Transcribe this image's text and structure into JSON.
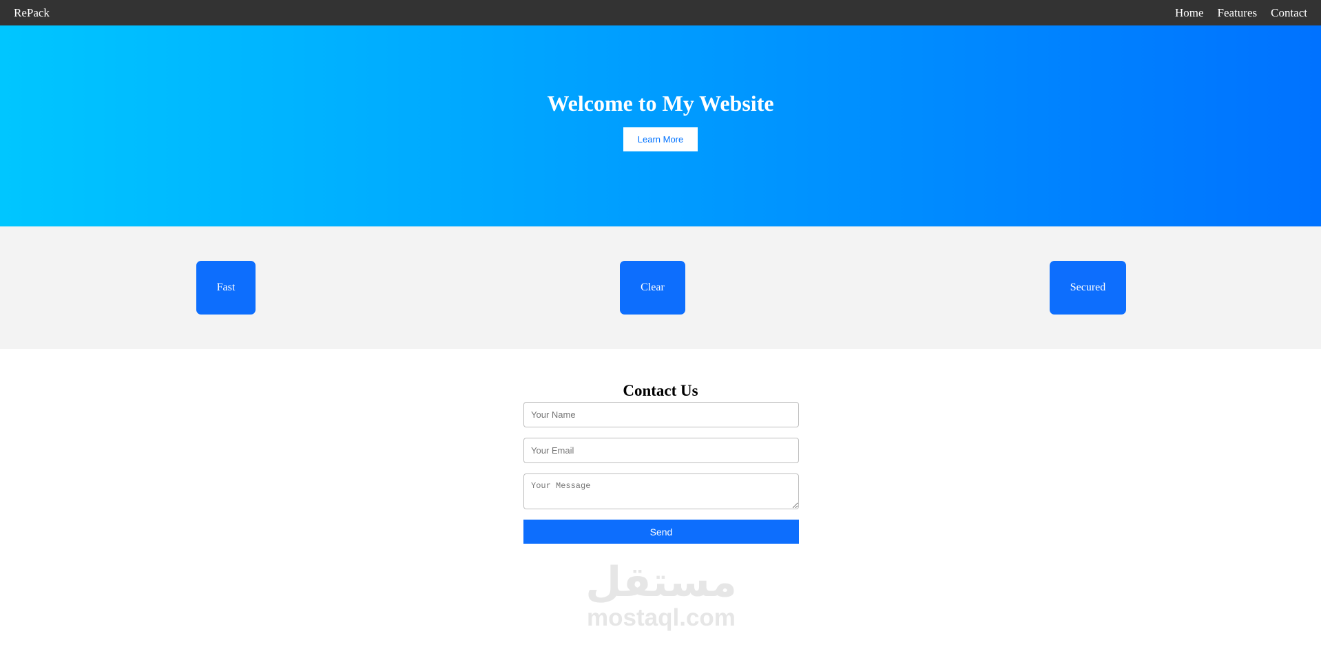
{
  "navbar": {
    "brand": "RePack",
    "links": [
      {
        "label": "Home"
      },
      {
        "label": "Features"
      },
      {
        "label": "Contact"
      }
    ]
  },
  "hero": {
    "title": "Welcome to My Website",
    "button_label": "Learn More",
    "gradient_start": "#00c6ff",
    "gradient_end": "#0072ff"
  },
  "features": {
    "items": [
      {
        "label": "Fast"
      },
      {
        "label": "Clear"
      },
      {
        "label": "Secured"
      }
    ],
    "card_color": "#0d6efd"
  },
  "contact": {
    "title": "Contact Us",
    "name_placeholder": "Your Name",
    "email_placeholder": "Your Email",
    "message_placeholder": "Your Message",
    "send_label": "Send"
  },
  "watermark": {
    "arabic": "مستقل",
    "domain": "mostaql.com"
  }
}
